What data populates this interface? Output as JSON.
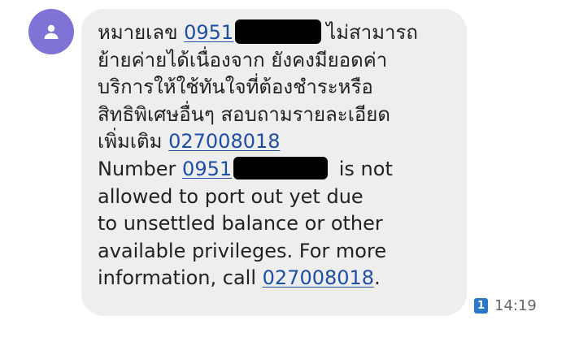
{
  "message": {
    "thai_line1_prefix": "หมายเลข ",
    "thai_number_visible": "0951",
    "thai_line1_suffix": "ไม่สามารถ",
    "thai_line2": "ย้ายค่ายได้เนื่องจาก ยังคงมียอดค่า",
    "thai_line3": "บริการให้ใช้ทันใจที่ต้องชำระหรือ",
    "thai_line4": "สิทธิพิเศษอื่นๆ สอบถามรายละเอียด",
    "thai_line5_prefix": "เพิ่มเติม ",
    "phone_link": "027008018",
    "en_line1_prefix": "Number ",
    "en_number_visible": "0951",
    "en_line1_suffix": " is not",
    "en_line2": "allowed to port out yet due",
    "en_line3": "to unsettled balance or other",
    "en_line4": "available privileges. For more",
    "en_line5_prefix": "information, call ",
    "en_line5_suffix": "."
  },
  "meta": {
    "sim_label": "1",
    "time": "14:19"
  },
  "icons": {
    "avatar": "person-icon",
    "sim": "sim-card-icon"
  },
  "colors": {
    "avatar_bg": "#7f73d6",
    "bubble_bg": "#eeeeee",
    "link": "#1f4ea8",
    "sim_badge": "#2979c8"
  }
}
